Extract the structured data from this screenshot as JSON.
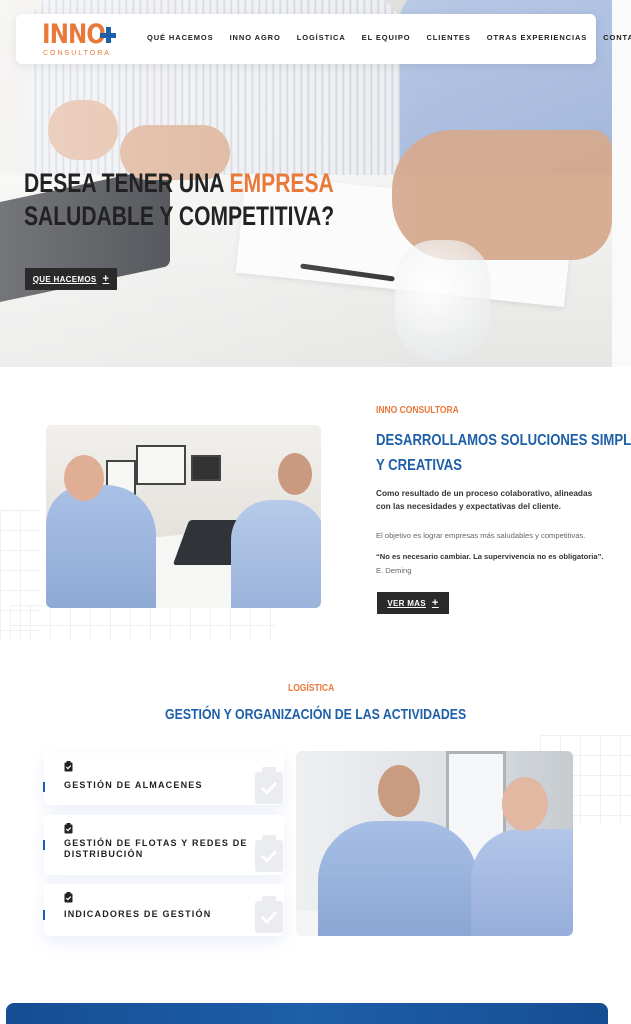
{
  "brand": {
    "logo_word": "INNO",
    "logo_sub": "CONSULTORA",
    "accent": "#e9793a",
    "blue": "#1d5fa8",
    "dark": "#2a2a2a"
  },
  "nav": {
    "items": [
      "QUÉ HACEMOS",
      "INNO AGRO",
      "LOGÍSTICA",
      "EL EQUIPO",
      "CLIENTES",
      "OTRAS EXPERIENCIAS",
      "CONTACTO"
    ]
  },
  "hero": {
    "title_line1_a": "DESEA TENER UNA ",
    "title_line1_b": "EMPRESA",
    "title_line2": "SALUDABLE Y COMPETITIVA?",
    "button_label": "QUE HACEMOS",
    "button_icon": "plus-icon"
  },
  "about": {
    "eyebrow": "INNO CONSULTORA",
    "title_line1": "DESARROLLAMOS SOLUCIONES SIMPLES",
    "title_line2": "Y CREATIVAS",
    "lead": "Como resultado de un proceso colaborativo, alineadas con las necesidades y expectativas del cliente.",
    "paragraph": "El objetivo es lograr empresas más saludables y competitivas.",
    "quote": "“No es necesario cambiar. La supervivencia no es obligatoria”.",
    "quote_author": "E. Deming",
    "button_label": "VER MAS",
    "button_icon": "plus-icon"
  },
  "logistics": {
    "eyebrow": "LOGÍSTICA",
    "title": "GESTIÓN Y ORGANIZACIÓN DE LAS ACTIVIDADES",
    "cards": [
      {
        "label": "GESTIÓN DE ALMACENES",
        "icon": "clipboard-check-icon"
      },
      {
        "label": "GESTIÓN DE FLOTAS Y REDES DE DISTRIBUCIÓN",
        "icon": "clipboard-check-icon"
      },
      {
        "label": "INDICADORES DE GESTIÓN",
        "icon": "clipboard-check-icon"
      }
    ]
  }
}
